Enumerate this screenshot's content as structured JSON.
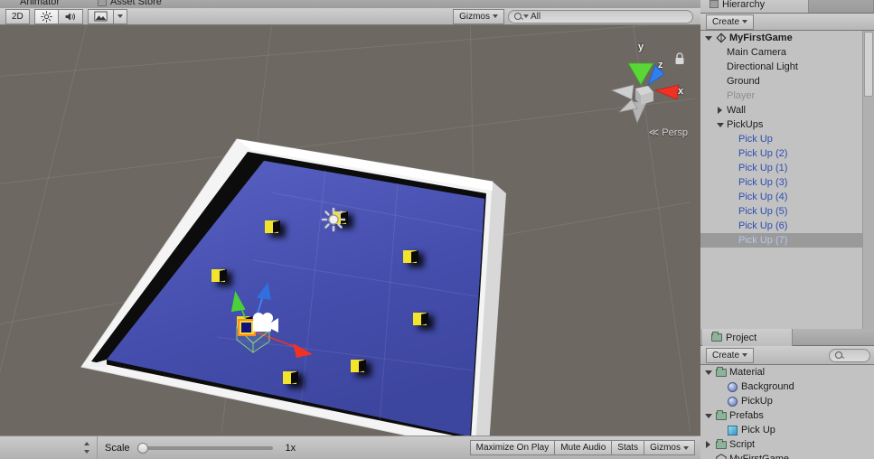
{
  "window": {
    "top_tabs": [
      {
        "label": "Animator",
        "icon": "animator-icon"
      },
      {
        "label": "Asset Store",
        "icon": "asset-store-icon"
      }
    ]
  },
  "scene_toolbar": {
    "draw_mode_label": "2D",
    "lighting_icon": "sun-icon",
    "audio_icon": "speaker-icon",
    "effects_icon": "image-icon",
    "effects_caret": "▾",
    "gizmos_label": "Gizmos",
    "gizmos_caret": "▾",
    "search_placeholder": "All",
    "search_value": "All",
    "search_icon": "search-icon"
  },
  "scene_view": {
    "gizmo": {
      "x_label": "x",
      "y_label": "y",
      "z_label": "z",
      "projection_label": "Persp",
      "projection_arrow": "≪",
      "lock_icon": "lock-icon"
    },
    "background_color": "#6d6862",
    "ground_color": "#4a53b4",
    "wall_color": "#f2f2f2",
    "pickup_color": "#f2e32c",
    "objects": {
      "pickups_visible": 8,
      "player_icon": "camera-gizmo-icon",
      "light_icon": "directional-light-gizmo-icon"
    }
  },
  "game_toolbar": {
    "stepper_icon": "updown-stepper-icon",
    "scale_label": "Scale",
    "scale_value": "1x",
    "scale_position_pct": 0,
    "maximize_label": "Maximize On Play",
    "mute_label": "Mute Audio",
    "stats_label": "Stats",
    "gizmos_label": "Gizmos",
    "gizmos_caret": "▾",
    "menu_icon": "panel-menu-icon"
  },
  "hierarchy": {
    "tab_label": "Hierarchy",
    "tab_icon": "hierarchy-icon",
    "create_label": "Create",
    "create_caret": "▾",
    "items": [
      {
        "label": "MyFirstGame",
        "indent": 0,
        "expander": "down",
        "icon": "unity-scene-icon",
        "style": "bold",
        "selected": false
      },
      {
        "label": "Main Camera",
        "indent": 1,
        "expander": "none",
        "icon": "none",
        "style": "normal",
        "selected": false
      },
      {
        "label": "Directional Light",
        "indent": 1,
        "expander": "none",
        "icon": "none",
        "style": "normal",
        "selected": false
      },
      {
        "label": "Ground",
        "indent": 1,
        "expander": "none",
        "icon": "none",
        "style": "normal",
        "selected": false
      },
      {
        "label": "Player",
        "indent": 1,
        "expander": "none",
        "icon": "none",
        "style": "disabled",
        "selected": false
      },
      {
        "label": "Wall",
        "indent": 1,
        "expander": "right",
        "icon": "none",
        "style": "normal",
        "selected": false
      },
      {
        "label": "PickUps",
        "indent": 1,
        "expander": "down",
        "icon": "none",
        "style": "normal",
        "selected": false
      },
      {
        "label": "Pick Up",
        "indent": 2,
        "expander": "none",
        "icon": "none",
        "style": "prefab",
        "selected": false
      },
      {
        "label": "Pick Up (2)",
        "indent": 2,
        "expander": "none",
        "icon": "none",
        "style": "prefab",
        "selected": false
      },
      {
        "label": "Pick Up (1)",
        "indent": 2,
        "expander": "none",
        "icon": "none",
        "style": "prefab",
        "selected": false
      },
      {
        "label": "Pick Up (3)",
        "indent": 2,
        "expander": "none",
        "icon": "none",
        "style": "prefab",
        "selected": false
      },
      {
        "label": "Pick Up (4)",
        "indent": 2,
        "expander": "none",
        "icon": "none",
        "style": "prefab",
        "selected": false
      },
      {
        "label": "Pick Up (5)",
        "indent": 2,
        "expander": "none",
        "icon": "none",
        "style": "prefab",
        "selected": false
      },
      {
        "label": "Pick Up (6)",
        "indent": 2,
        "expander": "none",
        "icon": "none",
        "style": "prefab",
        "selected": false
      },
      {
        "label": "Pick Up (7)",
        "indent": 2,
        "expander": "none",
        "icon": "none",
        "style": "prefab",
        "selected": true
      }
    ]
  },
  "project": {
    "tab_label": "Project",
    "tab_icon": "folder-icon",
    "create_label": "Create",
    "create_caret": "▾",
    "search_icon": "search-icon",
    "search_value": "",
    "items": [
      {
        "label": "Material",
        "indent": 0,
        "expander": "down",
        "icon": "folder",
        "style": "normal"
      },
      {
        "label": "Background",
        "indent": 1,
        "expander": "none",
        "icon": "sphere",
        "style": "normal"
      },
      {
        "label": "PickUp",
        "indent": 1,
        "expander": "none",
        "icon": "sphere",
        "style": "normal"
      },
      {
        "label": "Prefabs",
        "indent": 0,
        "expander": "down",
        "icon": "folder",
        "style": "normal"
      },
      {
        "label": "Pick Up",
        "indent": 1,
        "expander": "none",
        "icon": "prefab-cube",
        "style": "normal"
      },
      {
        "label": "Script",
        "indent": 0,
        "expander": "right",
        "icon": "folder",
        "style": "normal"
      },
      {
        "label": "MyFirstGame",
        "indent": 0,
        "expander": "none",
        "icon": "unity",
        "style": "normal"
      }
    ]
  }
}
